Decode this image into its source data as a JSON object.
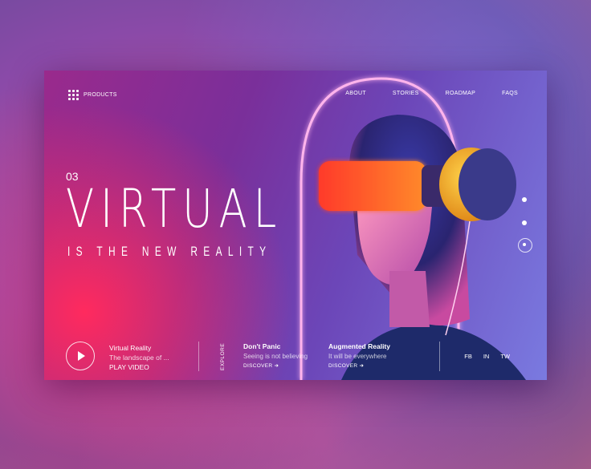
{
  "nav": {
    "products_label": "PRODUCTS",
    "links": [
      "ABOUT",
      "STORIES",
      "ROADMAP",
      "FAQS"
    ]
  },
  "hero": {
    "slide_number": "03",
    "title": "VIRTUAL",
    "subtitle": "IS THE NEW REALITY"
  },
  "slider": {
    "dot_count": 3,
    "active_index": 2
  },
  "video": {
    "title": "Virtual Reality",
    "description": "The landscape of ...",
    "action": "PLAY VIDEO"
  },
  "explore_label": "EXPLORE",
  "stories": [
    {
      "title": "Don't Panic",
      "description": "Seeing is not believing",
      "link": "DISCOVER"
    },
    {
      "title": "Augmented Reality",
      "description": "It will be everywhere",
      "link": "DISCOVER"
    }
  ],
  "social": [
    "FB",
    "IN",
    "TW"
  ],
  "colors": {
    "accent_pink": "#ff2a5e",
    "visor_orange": "#ff5a1f",
    "neon_ring": "#ff8ad8",
    "purple_bg": "#7a2f9a"
  },
  "icons": {
    "menu": "grid-menu-icon",
    "play": "play-icon",
    "arrow": "arrow-right-icon"
  }
}
